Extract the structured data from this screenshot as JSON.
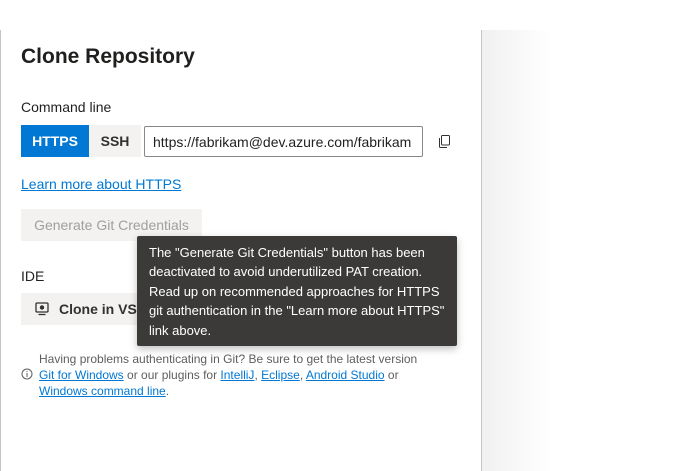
{
  "panel": {
    "title": "Clone Repository",
    "command_line_label": "Command line",
    "protocol_tabs": [
      {
        "label": "HTTPS",
        "selected": true
      },
      {
        "label": "SSH",
        "selected": false
      }
    ],
    "clone_url": "https://fabrikam@dev.azure.com/fabrikam",
    "learn_more_link": "Learn more about HTTPS",
    "generate_button": "Generate Git Credentials",
    "ide_label": "IDE",
    "clone_in_vs_button": "Clone in VS Code",
    "tooltip": "The \"Generate Git Credentials\" button has been deactivated to avoid underutilized PAT creation. Read up on recommended approaches for HTTPS git authentication in the \"Learn more about HTTPS\" link above."
  },
  "help": {
    "intro": "Having problems authenticating in Git? Be sure to get the latest version",
    "git_for_windows": "Git for Windows",
    "or_plugins": "or our plugins for",
    "intellij": "IntelliJ",
    "comma": ",",
    "eclipse": "Eclipse",
    "android_studio": "Android Studio",
    "or": "or",
    "windows_cmd": "Windows command line",
    "period": "."
  },
  "colors": {
    "accent": "#0078d4",
    "tooltip_bg": "#3b3a39",
    "disabled_text": "#a19f9d",
    "button_bg": "#f3f2f1"
  },
  "icons": {
    "copy": "copy-icon",
    "clone": "vscode-clone-icon",
    "info": "info-icon"
  }
}
